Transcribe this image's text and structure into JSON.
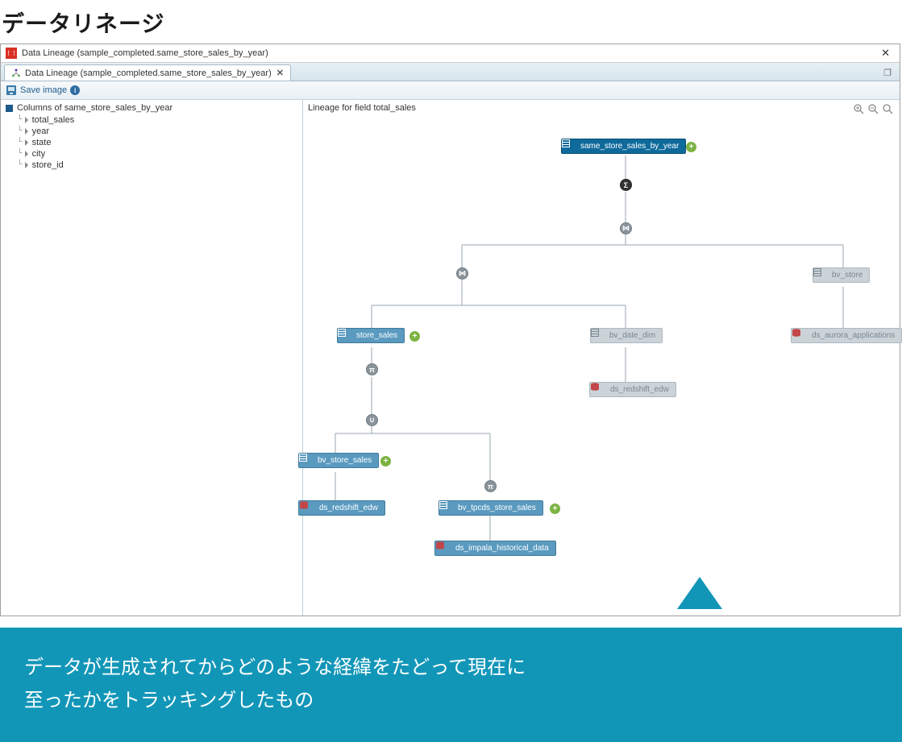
{
  "page_heading": "データリネージ",
  "window": {
    "title": "Data Lineage (sample_completed.same_store_sales_by_year)"
  },
  "tab": {
    "label": "Data Lineage (sample_completed.same_store_sales_by_year)"
  },
  "toolbar": {
    "save_image": "Save image"
  },
  "sidebar": {
    "root": "Columns of same_store_sales_by_year",
    "items": [
      "total_sales",
      "year",
      "state",
      "city",
      "store_id"
    ]
  },
  "canvas": {
    "title": "Lineage for field total_sales"
  },
  "nodes": {
    "root": "same_store_sales_by_year",
    "bv_store": "bv_store",
    "ds_aurora": "ds_aurora_applications",
    "store_sales": "store_sales",
    "bv_date_dim": "bv_date_dim",
    "ds_redshift1": "ds_redshift_edw",
    "bv_store_sales": "bv_store_sales",
    "ds_redshift2": "ds_redshift_edw",
    "bv_tpcds": "bv_tpcds_store_sales",
    "ds_impala": "ds_impala_historical_data"
  },
  "ops": {
    "sigma": "Σ",
    "join": "⋈",
    "pi": "π",
    "union": "∪"
  },
  "callout": {
    "line1": "データが生成されてからどのような経緯をたどって現在に",
    "line2": "至ったかをトラッキングしたもの"
  }
}
